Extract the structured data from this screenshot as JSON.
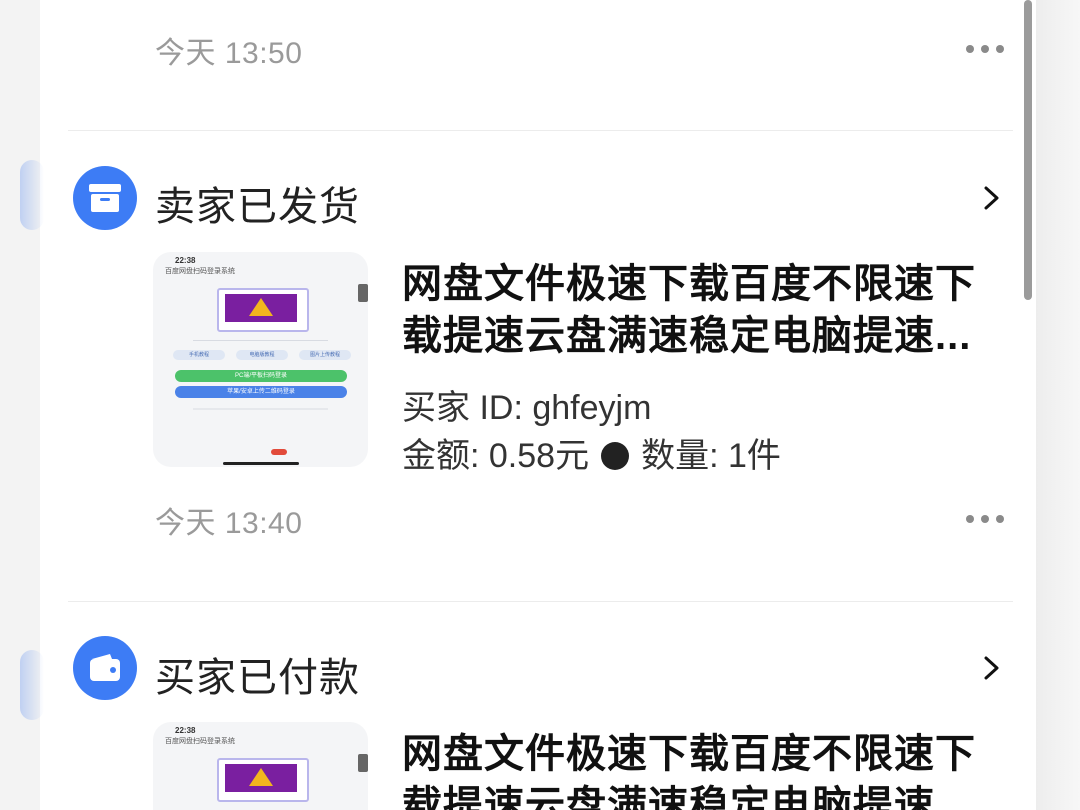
{
  "orders": [
    {
      "time": "今天 13:50"
    },
    {
      "status": "卖家已发货",
      "status_icon": "archive-box-icon",
      "product_title_line1": "网盘文件极速下载百度不限速下",
      "product_title_line2": "载提速云盘满速稳定电脑提速...",
      "buyer_id": "买家 ID: ghfeyjm",
      "amount": "金额: 0.58元",
      "quantity": "数量: 1件",
      "time": "今天 13:40",
      "thumbnail": {
        "status_time": "22:38",
        "page_title": "百度网盘扫码登录系统",
        "buttons": [
          "手机教程",
          "电脑版教程",
          "图片上传教程"
        ],
        "action1": "PC端/平板扫码登录",
        "action2": "苹果/安卓上传二维码登录"
      }
    },
    {
      "status": "买家已付款",
      "status_icon": "wallet-icon",
      "product_title_line1": "网盘文件极速下载百度不限速下",
      "product_title_line2": "载提速云盘满速稳定电脑提速...",
      "thumbnail": {
        "status_time": "22:38",
        "page_title": "百度网盘扫码登录系统"
      }
    }
  ],
  "colors": {
    "accent": "#3d7cf5",
    "text_primary": "#111111",
    "text_secondary": "#9a9a9a"
  }
}
